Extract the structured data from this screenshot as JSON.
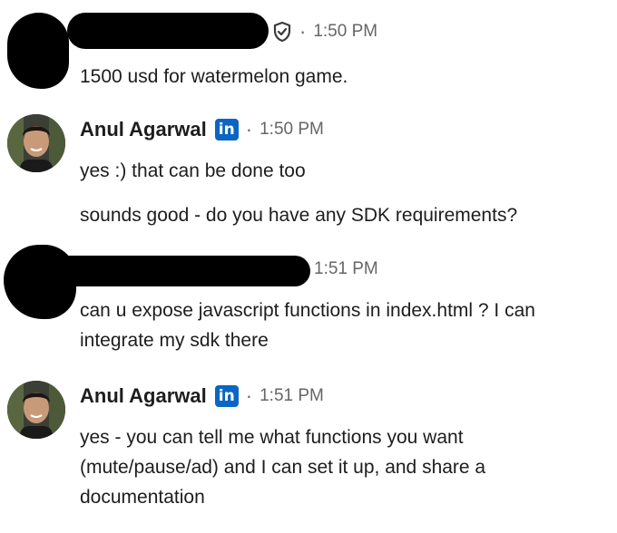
{
  "messages": [
    {
      "sender": "",
      "time": "1:50 PM",
      "lines": [
        "1500 usd for watermelon game."
      ]
    },
    {
      "sender": "Anul Agarwal",
      "badge": "in",
      "time": "1:50 PM",
      "lines": [
        "yes :) that can be done too"
      ],
      "extra": [
        "sounds good - do you have any SDK requirements?"
      ]
    },
    {
      "sender": "",
      "time": "1:51 PM",
      "lines": [
        "can u expose javascript functions in index.html ? I can",
        "integrate my sdk there"
      ]
    },
    {
      "sender": "Anul Agarwal",
      "badge": "in",
      "time": "1:51 PM",
      "lines": [
        "yes - you can tell me what functions you want",
        "(mute/pause/ad) and I can set it up, and share a",
        "documentation"
      ]
    }
  ],
  "separator": "·",
  "icons": {
    "verified": "shield-check-icon",
    "linkedin": "linkedin-badge-icon"
  },
  "colors": {
    "linkedin_blue": "#0a66c2",
    "meta_gray": "#666666",
    "text": "#1d1d1d"
  }
}
